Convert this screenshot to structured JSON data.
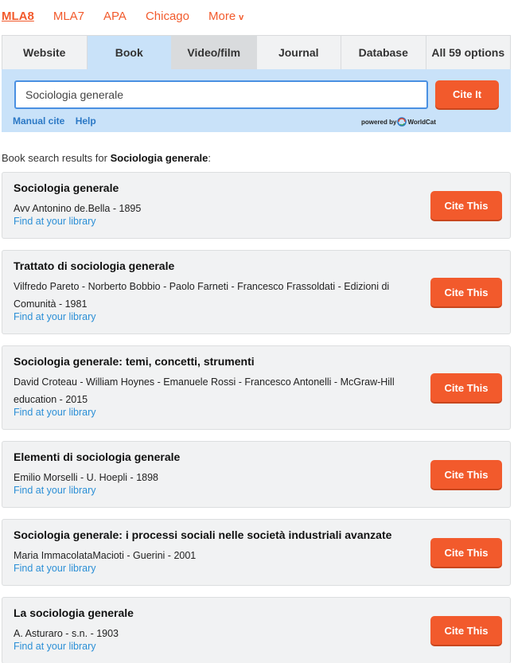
{
  "styles": [
    {
      "label": "MLA8",
      "active": true
    },
    {
      "label": "MLA7",
      "active": false
    },
    {
      "label": "APA",
      "active": false
    },
    {
      "label": "Chicago",
      "active": false
    },
    {
      "label": "More",
      "active": false,
      "icon": "chevron-down-icon"
    }
  ],
  "tabs": [
    "Website",
    "Book",
    "Video/film",
    "Journal",
    "Database",
    "All 59 options"
  ],
  "search": {
    "value": "Sociologia generale",
    "button_label": "Cite It",
    "manual_cite": "Manual cite",
    "help": "Help",
    "powered_prefix": "powered by",
    "powered_brand": "WorldCat"
  },
  "results": {
    "prefix": "Book search results for",
    "query": "Sociologia generale",
    "suffix": ":"
  },
  "books": [
    {
      "title": "Sociologia generale",
      "authors": "Avv Antonino de.Bella - 1895",
      "link": "Find at your library",
      "button": "Cite This"
    },
    {
      "title": "Trattato di sociologia generale",
      "authors": "Vilfredo Pareto - Norberto Bobbio - Paolo Farneti - Francesco Frassoldati - Edizioni di Comunità - 1981",
      "link": "Find at your library",
      "button": "Cite This"
    },
    {
      "title": "Sociologia generale: temi, concetti, strumenti",
      "authors": "David Croteau - William Hoynes - Emanuele Rossi - Francesco Antonelli - McGraw-Hill education - 2015",
      "link": "Find at your library",
      "button": "Cite This"
    },
    {
      "title": "Elementi di sociologia generale",
      "authors": "Emilio Morselli - U. Hoepli - 1898",
      "link": "Find at your library",
      "button": "Cite This"
    },
    {
      "title": "Sociologia generale: i processi sociali nelle società industriali avanzate",
      "authors": "Maria ImmacolataMacioti - Guerini - 2001",
      "link": "Find at your library",
      "button": "Cite This"
    },
    {
      "title": "La sociologia generale",
      "authors": "A. Asturaro - s.n. - 1903",
      "link": "Find at your library",
      "button": "Cite This"
    }
  ],
  "colors": {
    "accent": "#f25a2c",
    "link": "#2b8fd6",
    "search_bg": "#c9e2f9",
    "card_bg": "#f1f2f3"
  }
}
